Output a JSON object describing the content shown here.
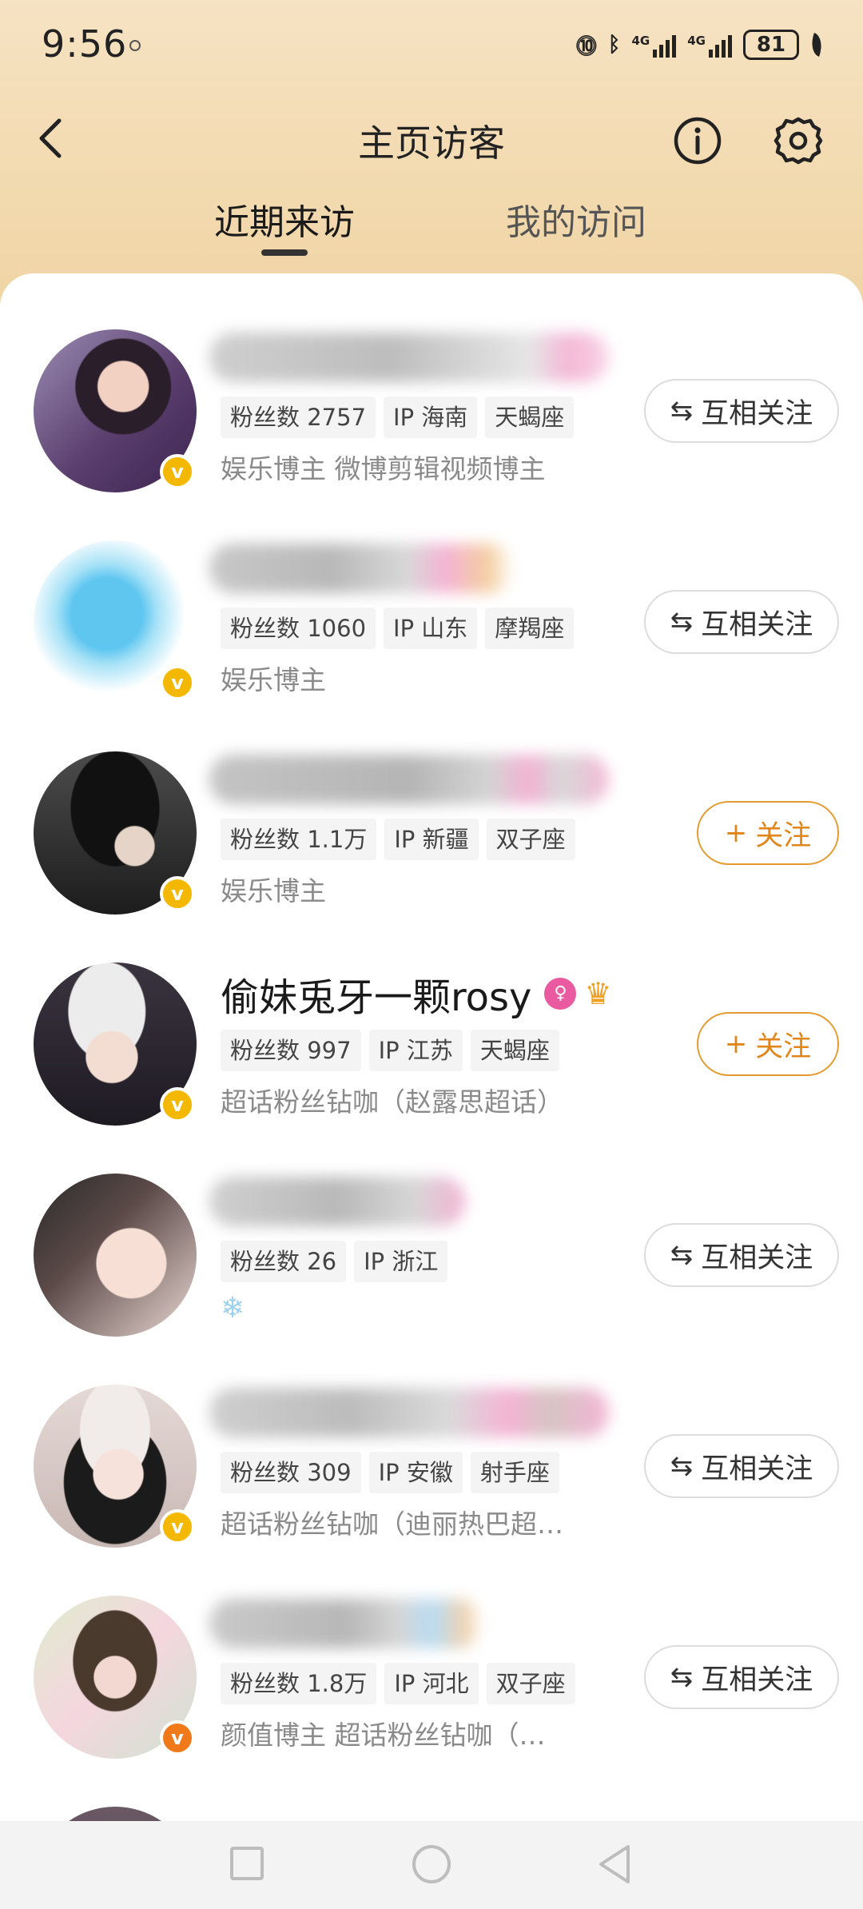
{
  "status": {
    "time": "9:56",
    "battery": "81",
    "net1": "4G",
    "net2": "4G"
  },
  "header": {
    "title": "主页访客"
  },
  "tabs": [
    {
      "label": "近期来访"
    },
    {
      "label": "我的访问"
    }
  ],
  "items": [
    {
      "tags": [
        "粉丝数 2757",
        "IP 海南",
        "天蝎座"
      ],
      "desc": "娱乐博主 微博剪辑视频博主",
      "button": "互相关注"
    },
    {
      "tags": [
        "粉丝数 1060",
        "IP 山东",
        "摩羯座"
      ],
      "desc": "娱乐博主",
      "button": "互相关注"
    },
    {
      "tags": [
        "粉丝数 1.1万",
        "IP 新疆",
        "双子座"
      ],
      "desc": "娱乐博主",
      "button": "关注"
    },
    {
      "name": "偷妹兎牙一颗rosy",
      "tags": [
        "粉丝数 997",
        "IP 江苏",
        "天蝎座"
      ],
      "desc": "超话粉丝钻咖（赵露思超话）",
      "button": "关注"
    },
    {
      "tags": [
        "粉丝数 26",
        "IP 浙江"
      ],
      "desc": "❄",
      "button": "互相关注"
    },
    {
      "tags": [
        "粉丝数 309",
        "IP 安徽",
        "射手座"
      ],
      "desc": "超话粉丝钻咖（迪丽热巴超…",
      "button": "互相关注"
    },
    {
      "tags": [
        "粉丝数 1.8万",
        "IP 河北",
        "双子座"
      ],
      "desc": "颜值博主 超话粉丝钻咖（…",
      "button": "互相关注"
    }
  ],
  "icons": {
    "verified": "v",
    "mutual": "⇆",
    "follow": "+"
  }
}
